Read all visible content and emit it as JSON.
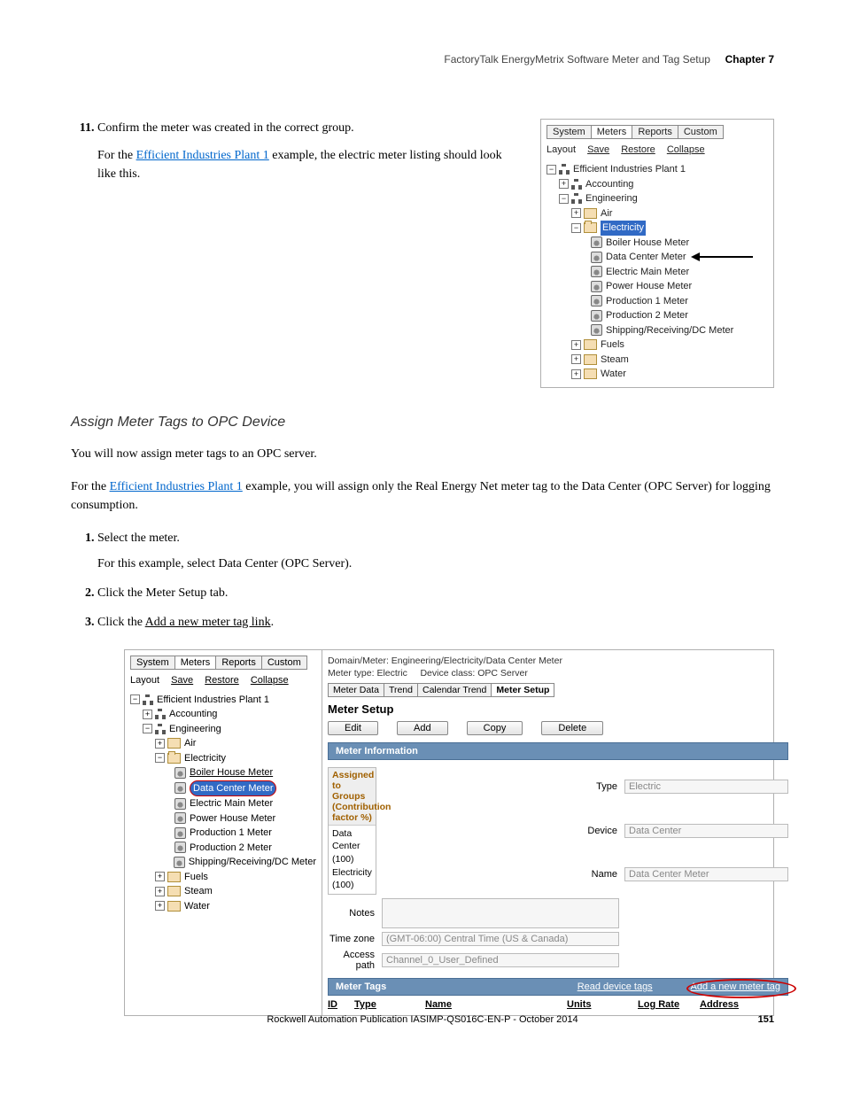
{
  "header": {
    "title_light": "FactoryTalk EnergyMetrix Software Meter and Tag Setup",
    "title_bold": "Chapter 7"
  },
  "step11": {
    "marker": "11.",
    "text": "Confirm the meter was created in the correct group.",
    "para_before": "For the ",
    "link": "Efficient Industries Plant 1",
    "para_after": " example, the electric meter listing should look like this."
  },
  "panel1": {
    "tabs": {
      "system": "System",
      "meters": "Meters",
      "reports": "Reports",
      "custom": "Custom"
    },
    "toolbar": {
      "layout": "Layout",
      "save": "Save",
      "restore": "Restore",
      "collapse": "Collapse"
    },
    "tree": {
      "root": "Efficient Industries Plant 1",
      "accounting": "Accounting",
      "engineering": "Engineering",
      "air": "Air",
      "electricity": "Electricity",
      "meters": {
        "boiler": "Boiler House Meter",
        "datacenter": "Data Center Meter",
        "main": "Electric Main Meter",
        "power": "Power House Meter",
        "prod1": "Production 1 Meter",
        "prod2": "Production 2 Meter",
        "ship": "Shipping/Receiving/DC Meter"
      },
      "fuels": "Fuels",
      "steam": "Steam",
      "water": "Water"
    }
  },
  "section_heading": "Assign Meter Tags to OPC Device",
  "intro_para": "You will now assign meter tags to an OPC server.",
  "para2_before": "For the ",
  "para2_link": "Efficient Industries Plant 1",
  "para2_after": " example, you will assign only the Real Energy Net meter tag to the Data Center (OPC Server) for logging consumption.",
  "steps_section": {
    "s1": "Select the meter.",
    "s1_detail": "For this example, select Data Center (OPC Server).",
    "s2": "Click the Meter Setup tab.",
    "s3_a": "Click the ",
    "s3_link": "Add a new meter tag link",
    "s3_b": "."
  },
  "panel2": {
    "breadcrumb": "Domain/Meter: Engineering/Electricity/Data Center Meter",
    "subline_a": "Meter type: Electric",
    "subline_b": "Device class: OPC Server",
    "subtabs": {
      "meterdata": "Meter Data",
      "trend": "Trend",
      "caltrend": "Calendar Trend",
      "setup": "Meter Setup"
    },
    "panel_title": "Meter Setup",
    "buttons": {
      "edit": "Edit",
      "add": "Add",
      "copy": "Copy",
      "delete": "Delete"
    },
    "section_info": "Meter Information",
    "form": {
      "type_label": "Type",
      "type_val": "Electric",
      "device_label": "Device",
      "device_val": "Data Center",
      "name_label": "Name",
      "name_val": "Data Center Meter",
      "notes_label": "Notes",
      "tz_label": "Time zone",
      "tz_val": "(GMT-06:00) Central Time (US & Canada)",
      "access_label": "Access path",
      "access_val": "Channel_0_User_Defined"
    },
    "sidebox": {
      "header": "Assigned to Groups (Contribution factor %)",
      "line1": "Data Center (100)",
      "line2": "Electricity (100)"
    },
    "section_tags": "Meter Tags",
    "read_link": "Read device tags",
    "add_link": "Add a new meter tag",
    "cols": {
      "id": "ID",
      "type": "Type",
      "name": "Name",
      "units": "Units",
      "lograte": "Log Rate",
      "address": "Address"
    }
  },
  "footer": {
    "pub": "Rockwell Automation Publication IASIMP-QS016C-EN-P - October 2014",
    "page": "151"
  }
}
